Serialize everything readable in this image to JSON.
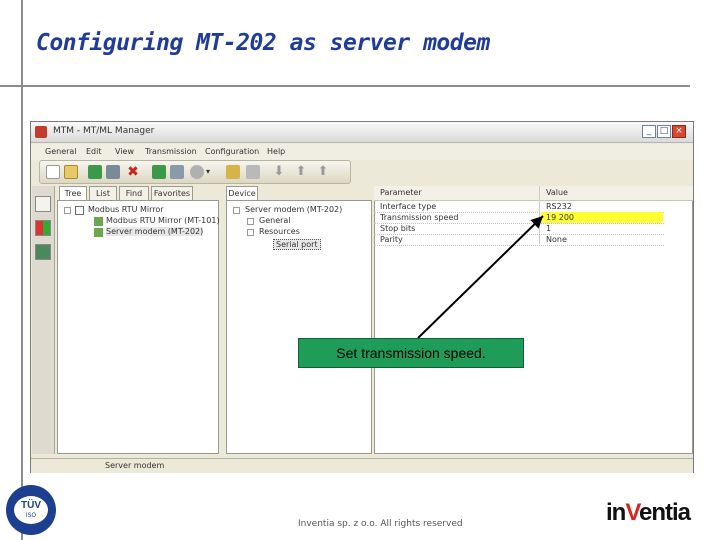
{
  "slide": {
    "title": "Configuring MT-202 as server modem",
    "footer": "Inventia sp. z o.o. All rights reserved"
  },
  "window": {
    "title": "MTM - MT/ML Manager",
    "menu": [
      "General",
      "Edit",
      "View",
      "Transmission",
      "Configuration",
      "Help"
    ],
    "status": "Server modem"
  },
  "left_panel": {
    "tabs": [
      "Tree",
      "List",
      "Find",
      "Favorites"
    ],
    "items": [
      "Modbus RTU Mirror",
      "Modbus RTU Mirror (MT-101)",
      "Server modem (MT-202)"
    ]
  },
  "device_panel": {
    "tab": "Device",
    "items": [
      "Server modem (MT-202)",
      "General",
      "Resources",
      "Serial port"
    ]
  },
  "params": {
    "header_param": "Parameter",
    "header_value": "Value",
    "rows": [
      {
        "param": "Interface type",
        "value": "RS232"
      },
      {
        "param": "Transmission speed",
        "value": "19 200"
      },
      {
        "param": "Stop bits",
        "value": "1"
      },
      {
        "param": "Parity",
        "value": "None"
      }
    ]
  },
  "callout": {
    "text": "Set transmission speed."
  },
  "logo": {
    "prefix": "in",
    "accent": "V",
    "suffix": "entia"
  },
  "tuv": {
    "text": "TÜV",
    "sub": "ISO"
  },
  "colors": {
    "title": "#1f3b9c",
    "callout": "#1e9c58",
    "highlight": "#ffff33",
    "logo_accent": "#d9271f"
  }
}
